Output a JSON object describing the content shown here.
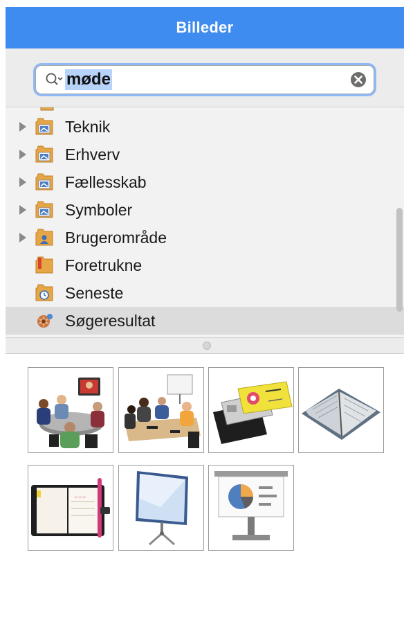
{
  "header": {
    "title": "Billeder"
  },
  "search": {
    "query": "møde"
  },
  "tree": {
    "items": [
      {
        "label": "Teknik",
        "expandable": true,
        "icon": "folder-image-icon"
      },
      {
        "label": "Erhverv",
        "expandable": true,
        "icon": "folder-image-icon"
      },
      {
        "label": "Fællesskab",
        "expandable": true,
        "icon": "folder-image-icon"
      },
      {
        "label": "Symboler",
        "expandable": true,
        "icon": "folder-image-icon"
      },
      {
        "label": "Brugerområde",
        "expandable": true,
        "icon": "folder-user-icon"
      },
      {
        "label": "Foretrukne",
        "expandable": false,
        "icon": "folder-favorites-icon"
      },
      {
        "label": "Seneste",
        "expandable": false,
        "icon": "folder-recent-icon"
      },
      {
        "label": "Søgeresultat",
        "expandable": false,
        "icon": "search-result-icon",
        "selected": true
      }
    ]
  },
  "results": {
    "thumbnails": [
      {
        "icon": "meeting-videoconference-icon"
      },
      {
        "icon": "meeting-presentation-icon"
      },
      {
        "icon": "business-cards-icon"
      },
      {
        "icon": "notebook-icon"
      },
      {
        "icon": "planner-icon"
      },
      {
        "icon": "projection-screen-icon"
      },
      {
        "icon": "presentation-pie-chart-icon"
      }
    ]
  },
  "colors": {
    "header": "#3f8cf0",
    "selection": "#b7d3f9",
    "selected_row": "#dcdcdc"
  }
}
